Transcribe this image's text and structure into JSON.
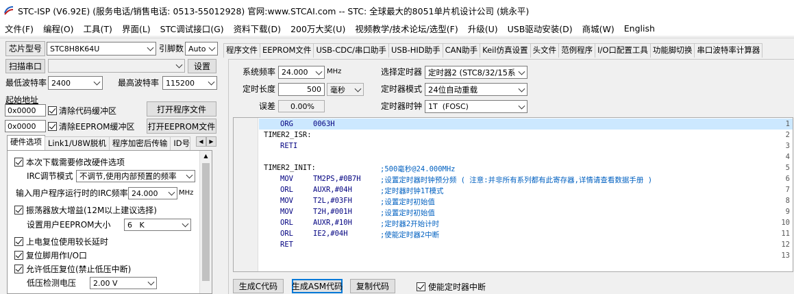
{
  "app": {
    "title": "STC-ISP (V6.92E) (服务电话/销售电话: 0513-55012928) 官网:www.STCAI.com  -- STC: 全球最大的8051单片机设计公司 (姚永平)"
  },
  "menu": [
    "文件(F)",
    "编程(O)",
    "工具(T)",
    "界面(L)",
    "STC调试接口(G)",
    "资料下载(D)",
    "200万大奖(U)",
    "视频教学/技术论坛/选型(F)",
    "升级(U)",
    "USB驱动安装(D)",
    "商城(W)",
    "English"
  ],
  "left": {
    "chip_label": "芯片型号",
    "chip_value": "STC8H8K64U",
    "pin_label": "引脚数",
    "pin_value": "Auto",
    "scan_button": "扫描串口",
    "port_value": "",
    "settings_button": "设置",
    "min_baud_label": "最低波特率",
    "min_baud_value": "2400",
    "max_baud_label": "最高波特率",
    "max_baud_value": "115200",
    "start_addr_label": "起始地址",
    "addr1": "0x0000",
    "clear_code_label": "清除代码缓冲区",
    "open_prog_button": "打开程序文件",
    "addr2": "0x0000",
    "clear_eeprom_label": "清除EEPROM缓冲区",
    "open_eeprom_button": "打开EEPROM文件",
    "tabs": [
      "硬件选项",
      "Link1/U8W脱机",
      "程序加密后传输",
      "ID号"
    ],
    "options": {
      "modify_hw": "本次下载需要修改硬件选项",
      "irc_mode_label": "IRC调节模式",
      "irc_mode_value": "不调节,使用内部预置的频率",
      "irc_freq_label": "输入用户程序运行时的IRC频率",
      "irc_freq_value": "24.000",
      "irc_freq_unit": "MHz",
      "osc_gain": "振荡器放大增益(12M以上建议选择)",
      "eeprom_size_label": "设置用户EEPROM大小",
      "eeprom_size_value": "6   K",
      "power_on_delay": "上电复位使用较长延时",
      "reset_pin": "复位脚用作I/O口",
      "low_volt_reset": "允许低压复位(禁止低压中断)",
      "low_volt_label": "低压检测电压",
      "low_volt_value": "2.00 V"
    }
  },
  "right": {
    "tabs": [
      "程序文件",
      "EEPROM文件",
      "USB-CDC/串口助手",
      "USB-HID助手",
      "CAN助手",
      "Keil仿真设置",
      "头文件",
      "范例程序",
      "I/O口配置工具",
      "功能脚切换",
      "串口波特率计算器"
    ],
    "sys_freq_label": "系统频率",
    "sys_freq_value": "24.000",
    "sys_freq_unit": "MHz",
    "timer_len_label": "定时长度",
    "timer_len_value": "500",
    "timer_len_unit": "毫秒",
    "error_label": "误差",
    "error_value": "0.00%",
    "select_timer_label": "选择定时器",
    "select_timer_value": "定时器2 (STC8/32/15系",
    "timer_mode_label": "定时器模式",
    "timer_mode_value": "24位自动重载",
    "timer_clock_label": "定时器时钟",
    "timer_clock_value": "1T  (FOSC)",
    "code_lines": [
      {
        "n": "1",
        "label": "",
        "op": "ORG",
        "arg": "0063H",
        "cm": ""
      },
      {
        "n": "2",
        "label": "TIMER2_ISR:",
        "op": "",
        "arg": "",
        "cm": ""
      },
      {
        "n": "3",
        "label": "",
        "op": "RETI",
        "arg": "",
        "cm": ""
      },
      {
        "n": "4",
        "label": "",
        "op": "",
        "arg": "",
        "cm": ""
      },
      {
        "n": "5",
        "label": "TIMER2_INIT:",
        "op": "",
        "arg": "",
        "cm": ";500毫秒@24.000MHz"
      },
      {
        "n": "6",
        "label": "",
        "op": "MOV",
        "arg": "TM2PS,#0B7H",
        "cm": ";设置定时器时钟预分频 ( 注意:并非所有系列都有此寄存器,详情请查看数据手册 )"
      },
      {
        "n": "7",
        "label": "",
        "op": "ORL",
        "arg": "AUXR,#04H",
        "cm": ";定时器时钟1T模式"
      },
      {
        "n": "8",
        "label": "",
        "op": "MOV",
        "arg": "T2L,#03FH",
        "cm": ";设置定时初始值"
      },
      {
        "n": "9",
        "label": "",
        "op": "MOV",
        "arg": "T2H,#001H",
        "cm": ";设置定时初始值"
      },
      {
        "n": "10",
        "label": "",
        "op": "ORL",
        "arg": "AUXR,#10H",
        "cm": ";定时器2开始计时"
      },
      {
        "n": "11",
        "label": "",
        "op": "ORL",
        "arg": "IE2,#04H",
        "cm": ";使能定时器2中断"
      },
      {
        "n": "12",
        "label": "",
        "op": "RET",
        "arg": "",
        "cm": ""
      },
      {
        "n": "13",
        "label": "",
        "op": "",
        "arg": "",
        "cm": ""
      }
    ],
    "gen_c_button": "生成C代码",
    "gen_asm_button": "生成ASM代码",
    "copy_button": "复制代码",
    "enable_int_label": "使能定时器中断"
  }
}
